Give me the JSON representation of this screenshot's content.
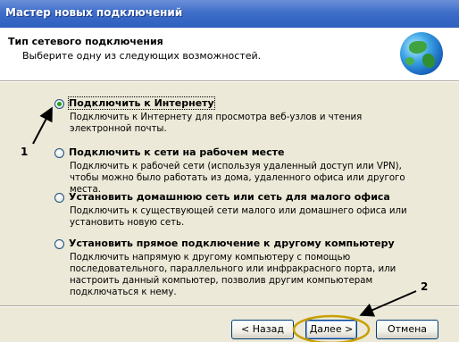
{
  "window": {
    "title": "Мастер новых подключений"
  },
  "header": {
    "title": "Тип сетевого подключения",
    "subtitle": "Выберите одну из следующих возможностей."
  },
  "options": [
    {
      "label": "Подключить к Интернету",
      "selected": true,
      "description": "Подключить к Интернету для просмотра веб-узлов и чтения электронной почты."
    },
    {
      "label": "Подключить к сети на рабочем месте",
      "selected": false,
      "description": "Подключить к рабочей сети (используя удаленный доступ или VPN), чтобы можно было работать из дома, удаленного офиса или другого места."
    },
    {
      "label": "Установить домашнюю сеть или сеть для малого офиса",
      "selected": false,
      "description": "Подключить к существующей сети малого или домашнего офиса или установить новую сеть."
    },
    {
      "label": "Установить прямое подключение к другому компьютеру",
      "selected": false,
      "description": "Подключить напрямую к другому компьютеру с помощью последовательного, параллельного или инфракрасного порта, или настроить данный компьютер, позволив другим компьютерам подключаться к нему."
    }
  ],
  "annotations": {
    "marker1": "1",
    "marker2": "2"
  },
  "buttons": {
    "back": "< Назад",
    "next": "Далее >",
    "cancel": "Отмена"
  },
  "icons": {
    "header": "network-globe-icon"
  },
  "colors": {
    "titlebar": "#3e6ec9",
    "body": "#ece9d8",
    "highlight_circle": "#c8a000",
    "annotation": "#000000"
  }
}
